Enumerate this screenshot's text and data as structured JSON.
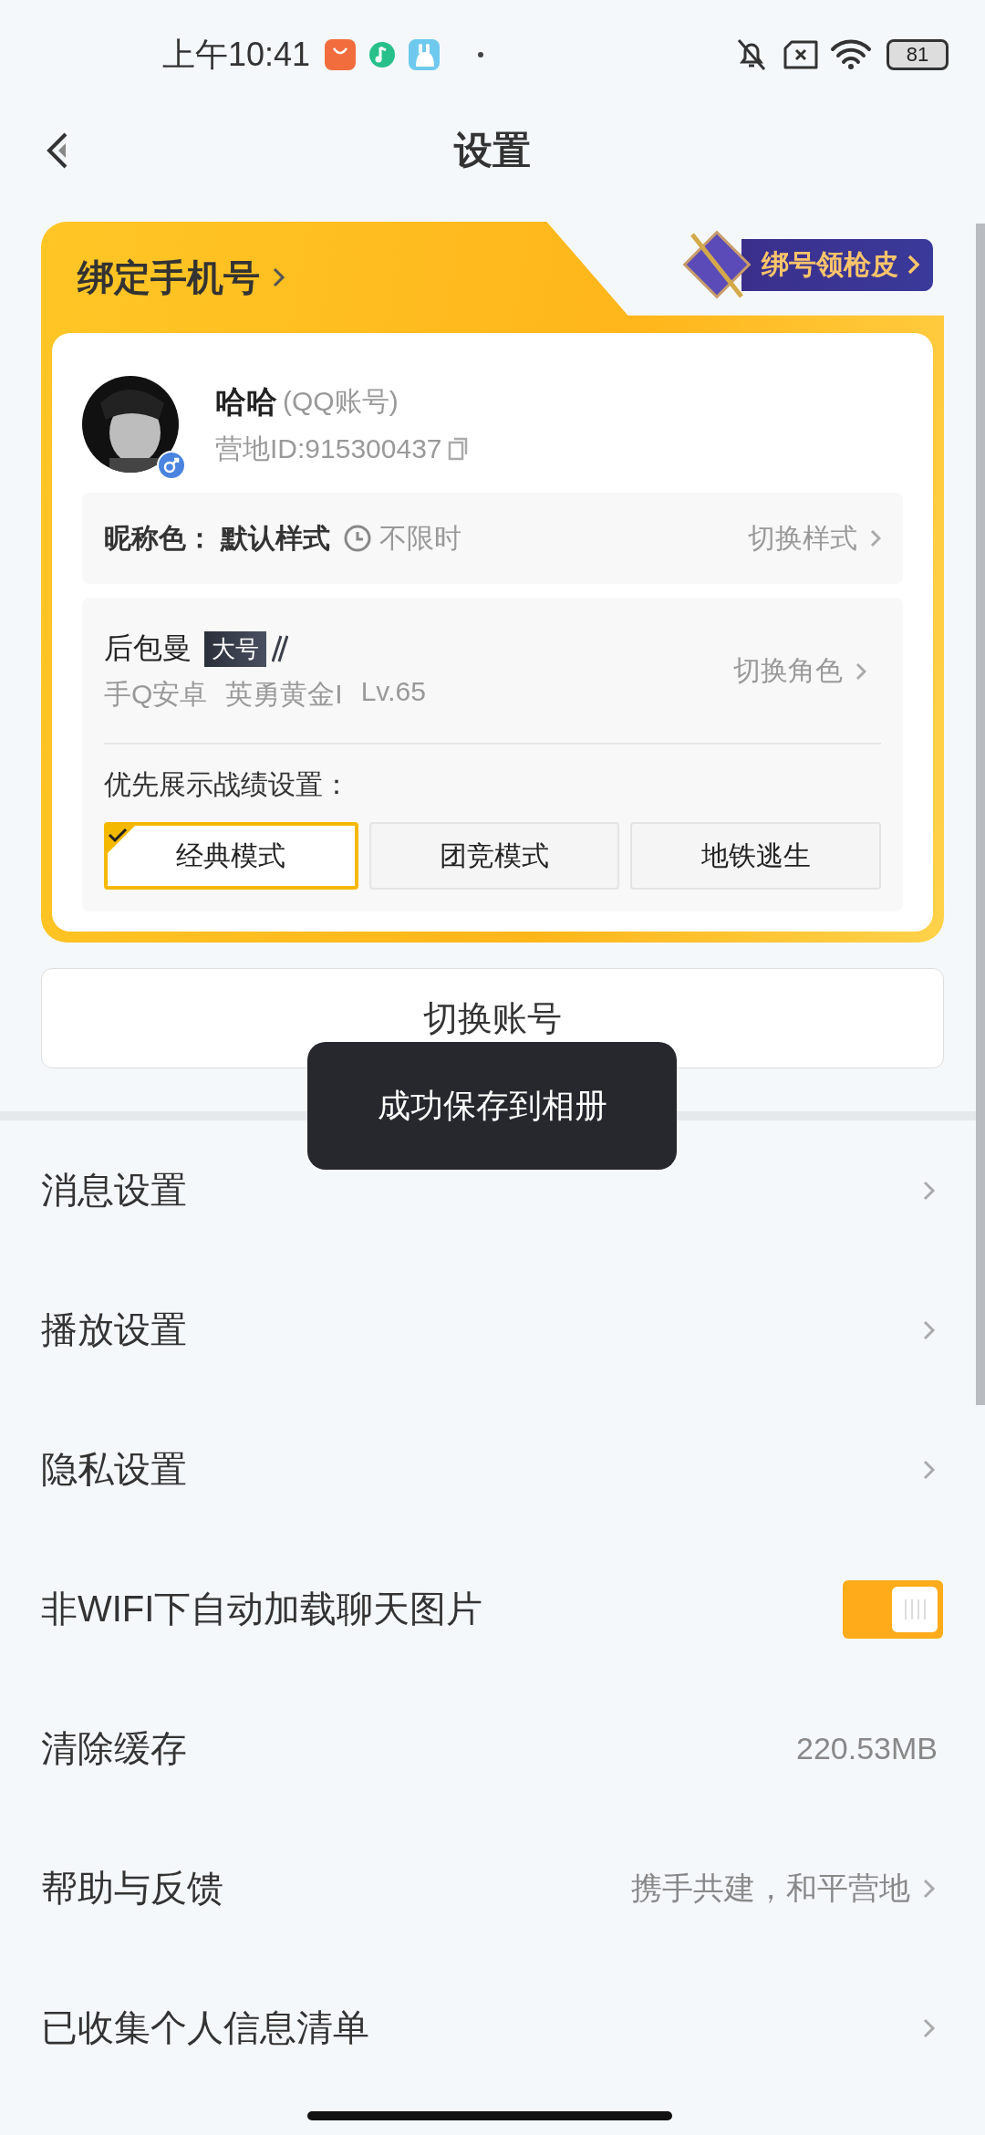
{
  "status_bar": {
    "time": "上午10:41",
    "battery": "81"
  },
  "header": {
    "title": "设置"
  },
  "bind_card": {
    "title": "绑定手机号",
    "promo": "绑号领枪皮",
    "profile": {
      "name": "哈哈",
      "account_type": "(QQ账号)",
      "camp_id": "营地ID:915300437"
    },
    "nickname_color": {
      "label": "昵称色：",
      "value": "默认样式",
      "duration": "不限时",
      "action": "切换样式"
    },
    "role": {
      "name": "后包曼",
      "tag": "大号",
      "platform": "手Q安卓",
      "rank": "英勇黄金I",
      "level_text": "Lv.65",
      "action": "切换角色",
      "priority_label": "优先展示战绩设置：",
      "modes": [
        {
          "label": "经典模式",
          "selected": true
        },
        {
          "label": "团竞模式",
          "selected": false
        },
        {
          "label": "地铁逃生",
          "selected": false
        }
      ]
    }
  },
  "switch_account": "切换账号",
  "toast": "成功保存到相册",
  "settings": {
    "items": [
      {
        "kind": "link",
        "label": "消息设置"
      },
      {
        "kind": "link",
        "label": "播放设置"
      },
      {
        "kind": "link",
        "label": "隐私设置"
      },
      {
        "kind": "toggle",
        "label": "非WIFI下自动加载聊天图片",
        "on": true
      },
      {
        "kind": "value",
        "label": "清除缓存",
        "value": "220.53MB"
      },
      {
        "kind": "link",
        "label": "帮助与反馈",
        "value": "携手共建，和平营地"
      },
      {
        "kind": "link",
        "label": "已收集个人信息清单"
      }
    ]
  }
}
